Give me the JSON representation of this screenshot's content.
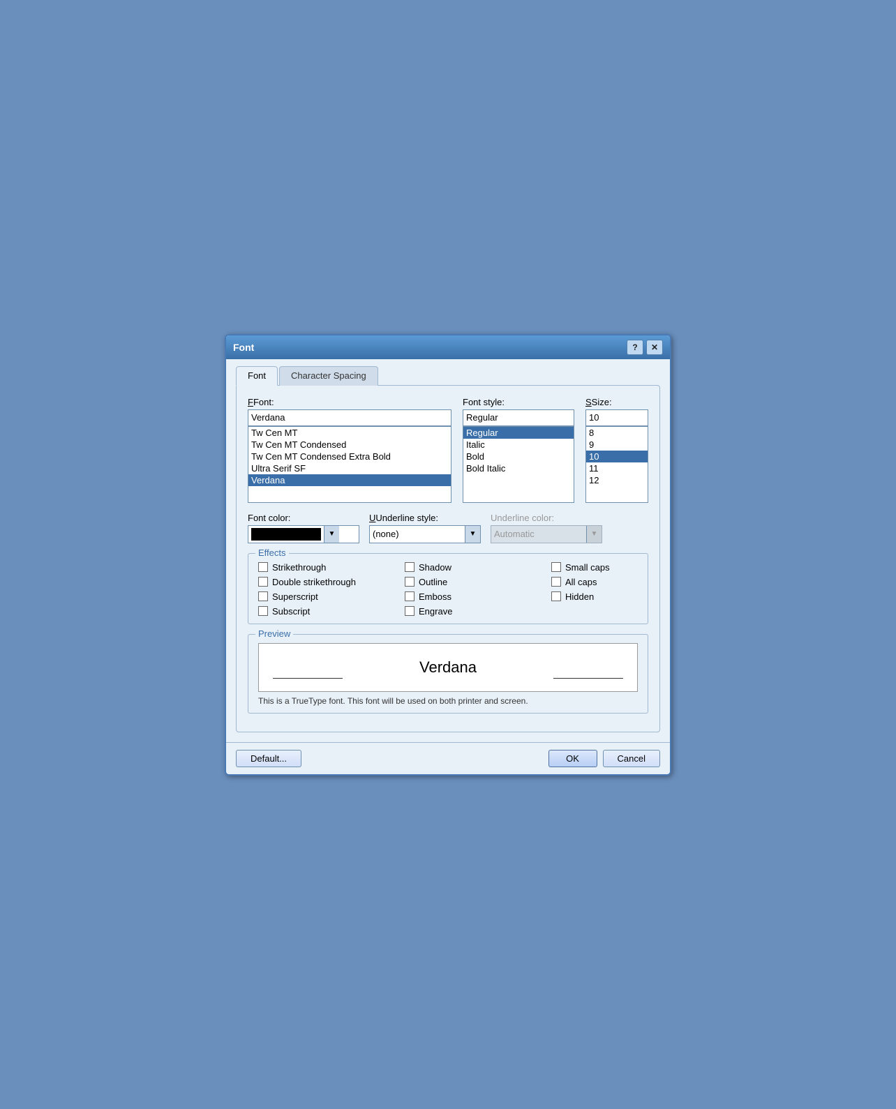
{
  "dialog": {
    "title": "Font",
    "help_btn": "?",
    "close_btn": "✕"
  },
  "tabs": [
    {
      "id": "font",
      "label": "Font",
      "active": true
    },
    {
      "id": "character-spacing",
      "label": "Character Spacing",
      "active": false
    }
  ],
  "font_tab": {
    "font_label": "Font:",
    "font_value": "Verdana",
    "font_list": [
      {
        "text": "Tw Cen MT",
        "selected": false
      },
      {
        "text": "Tw Cen MT Condensed",
        "selected": false
      },
      {
        "text": "Tw Cen MT Condensed Extra Bold",
        "selected": false
      },
      {
        "text": "Ultra Serif SF",
        "selected": false
      },
      {
        "text": "Verdana",
        "selected": true
      }
    ],
    "style_label": "Font style:",
    "style_value": "Regular",
    "style_list": [
      {
        "text": "Regular",
        "selected": true
      },
      {
        "text": "Italic",
        "selected": false
      },
      {
        "text": "Bold",
        "selected": false
      },
      {
        "text": "Bold Italic",
        "selected": false
      }
    ],
    "size_label": "Size:",
    "size_value": "10",
    "size_list": [
      {
        "text": "8",
        "selected": false
      },
      {
        "text": "9",
        "selected": false
      },
      {
        "text": "10",
        "selected": true
      },
      {
        "text": "11",
        "selected": false
      },
      {
        "text": "12",
        "selected": false
      }
    ],
    "color_label": "Font color:",
    "underline_style_label": "Underline style:",
    "underline_style_value": "(none)",
    "underline_color_label": "Underline color:",
    "underline_color_value": "Automatic",
    "effects_title": "Effects",
    "effects": [
      {
        "label": "Strikethrough",
        "checked": false
      },
      {
        "label": "Shadow",
        "checked": false
      },
      {
        "label": "Small caps",
        "checked": false
      },
      {
        "label": "Double strikethrough",
        "checked": false
      },
      {
        "label": "Outline",
        "checked": false
      },
      {
        "label": "All caps",
        "checked": false
      },
      {
        "label": "Superscript",
        "checked": false
      },
      {
        "label": "Emboss",
        "checked": false
      },
      {
        "label": "Hidden",
        "checked": false
      },
      {
        "label": "Subscript",
        "checked": false
      },
      {
        "label": "Engrave",
        "checked": false
      }
    ],
    "preview_title": "Preview",
    "preview_text": "Verdana",
    "preview_info": "This is a TrueType font. This font will be used on both printer and screen."
  },
  "buttons": {
    "default": "Default...",
    "ok": "OK",
    "cancel": "Cancel"
  }
}
